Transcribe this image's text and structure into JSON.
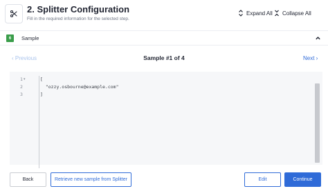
{
  "header": {
    "icon": "scissors-icon",
    "title": "2. Splitter Configuration",
    "subtitle": "Fill in the required information for the selected step.",
    "expand_all": "Expand All",
    "collapse_all": "Collapse All"
  },
  "section": {
    "badge": "6",
    "label": "Sample",
    "badge_color": "#3a9d4a"
  },
  "pager": {
    "previous": "Previous",
    "title": "Sample #1 of 4",
    "next": "Next"
  },
  "editor": {
    "line_numbers": [
      "1",
      "2",
      "3"
    ],
    "lines": [
      "[",
      "  \"ozzy.osbourne@example.com\"",
      "]"
    ]
  },
  "footer": {
    "back": "Back",
    "retrieve": "Retrieve new sample from Splitter",
    "edit": "Edit",
    "continue": "Continue"
  },
  "colors": {
    "accent": "#2f6bd8",
    "disabled_link": "#a9c3ec"
  }
}
